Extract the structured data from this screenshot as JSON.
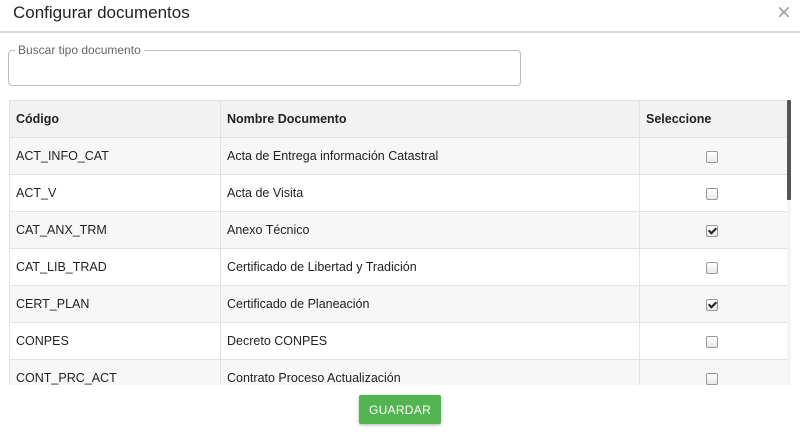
{
  "dialog": {
    "title": "Configurar documentos",
    "close_glyph": "×"
  },
  "search": {
    "legend": "Buscar tipo documento",
    "value": "",
    "placeholder": ""
  },
  "table": {
    "headers": [
      "Código",
      "Nombre Documento",
      "Seleccione"
    ],
    "rows": [
      {
        "codigo": "ACT_INFO_CAT",
        "nombre": "Acta de Entrega información Catastral",
        "selected": false
      },
      {
        "codigo": "ACT_V",
        "nombre": "Acta de Visita",
        "selected": false
      },
      {
        "codigo": "CAT_ANX_TRM",
        "nombre": "Anexo Técnico",
        "selected": true
      },
      {
        "codigo": "CAT_LIB_TRAD",
        "nombre": "Certificado de Libertad y Tradición",
        "selected": false
      },
      {
        "codigo": "CERT_PLAN",
        "nombre": "Certificado de Planeación",
        "selected": true
      },
      {
        "codigo": "CONPES",
        "nombre": "Decreto CONPES",
        "selected": false
      },
      {
        "codigo": "CONT_PRC_ACT",
        "nombre": "Contrato Proceso Actualización",
        "selected": false
      }
    ]
  },
  "footer": {
    "save_label": "GUARDAR"
  },
  "colors": {
    "accent_green": "#52b552",
    "header_bg": "#f2f2f2",
    "stripe_bg": "#f7f7f7"
  }
}
